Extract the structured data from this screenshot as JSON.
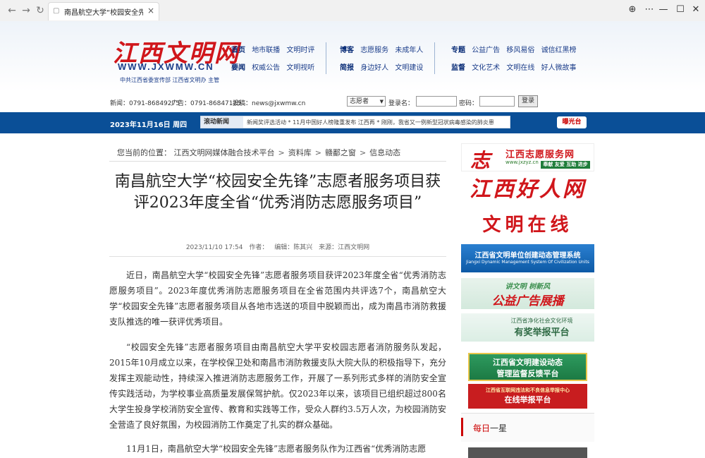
{
  "browser": {
    "tab_title": "南昌航空大学“校园安全先锋”",
    "back_icon": "←",
    "forward_icon": "→",
    "reload_icon": "↻",
    "close_tab": "×",
    "globe_icon": "⊕",
    "menu_icon": "⋯",
    "min_icon": "—",
    "max_icon": "☐",
    "close_icon": "✕"
  },
  "header": {
    "logo_text": "江西文明网",
    "logo_url": "WWW.JXWMW.CN",
    "logo_sub": "中共江西省委宣传部  江西省文明办 主管",
    "nav_group1": {
      "row1": [
        "首页",
        "地市联播",
        "文明时评"
      ],
      "row2": [
        "要闻",
        "权威公告",
        "文明视听"
      ]
    },
    "nav_group2": {
      "row1": [
        "博客",
        "志愿服务",
        "未成年人"
      ],
      "row2": [
        "简报",
        "身边好人",
        "文明建设"
      ]
    },
    "nav_group3": {
      "row1": [
        "专题",
        "公益广告",
        "移风易俗",
        "诚信红黑榜"
      ],
      "row2": [
        "监督",
        "文化艺术",
        "文明在线",
        "好人微故事"
      ]
    }
  },
  "infobar": {
    "news_tel": "新闻：0791-86849275",
    "ad_tel": "广告：0791-86847125",
    "email": "投稿：news@jxwmw.cn",
    "select_value": "志愿者",
    "login_name_label": "登录名：",
    "password_label": "密码：",
    "login_button": "登录"
  },
  "bluebar": {
    "date": "2023年11月16日 周四",
    "scroll_label": "滚动新闻",
    "scroll_text": "新闻奖评选活动 * 11月中国好人榜隆重发布 江西再   * 刚刚，我省又一例新型冠状病毒感染的肺炎患",
    "expose_button": "曝光台"
  },
  "breadcrumb": {
    "prefix": "您当前的位置：",
    "items": [
      "江西文明网媒体融合技术平台",
      "资料库",
      "赣鄱之窗",
      "信息动态"
    ],
    "sep": ">"
  },
  "article": {
    "title": "南昌航空大学“校园安全先锋”志愿者服务项目获评2023年度全省“优秀消防志愿服务项目”",
    "datetime": "2023/11/10 17:54",
    "author": "作者：",
    "editor": "编辑：陈其兴",
    "source": "来源：江西文明网",
    "paragraphs": [
      "近日，南昌航空大学“校园安全先锋”志愿者服务项目获评2023年度全省“优秀消防志愿服务项目”。2023年度优秀消防志愿服务项目在全省范围内共评选7个，南昌航空大学“校园安全先锋”志愿者服务项目从各地市选送的项目中脱颖而出，成为南昌市消防救援支队推选的唯一获评优秀项目。",
      "“校园安全先锋”志愿者服务项目由南昌航空大学平安校园志愿者消防服务队发起，2015年10月成立以来，在学校保卫处和南昌市消防救援支队大院大队的积极指导下，充分发挥主观能动性，持续深入推进消防志愿服务工作，开展了一系列形式多样的消防安全宣传实践活动，为学校事业高质量发展保驾护航。仅2023年以来，该项目已组织超过800名大学生投身学校消防安全宣传、教育和实践等工作，受众人群约3.5万人次，为校园消防安全营造了良好氛围，为校园消防工作奠定了扎实的群众基础。",
      "11月1日，南昌航空大学“校园安全先锋”志愿者服务队作为江西省“优秀消防志愿"
    ]
  },
  "sidebar": {
    "volunteer_banner": "江西志愿服务网",
    "volunteer_glyph": "志",
    "volunteer_url": "www.jxzyz.cn",
    "volunteer_tags": "奉献  友爱  互助  进步",
    "haoren_banner": "江西好人网",
    "wenming_banner": "文明在线",
    "unit_banner": "江西省文明单位创建动态管理系统",
    "unit_banner_en": "Jiangxi Dynamic Management System Of Civilization Units",
    "gongyi_top": "讲文明  树新风",
    "gongyi_banner": "公益广告展播",
    "report_top": "江西省净化社会文化环境",
    "report_banner": "有奖举报平台",
    "supervise_banner1": "江西省文明建设动态",
    "supervise_banner2": "管理监督反馈平台",
    "online_report_top": "江西省互联网违法和不良信息举报中心",
    "online_report": "在线举报平台",
    "daily_title": "每日一星"
  },
  "colors": {
    "brand_red": "#d0161b",
    "brand_blue": "#0a4f97",
    "nav_blue": "#1b3d8a"
  }
}
